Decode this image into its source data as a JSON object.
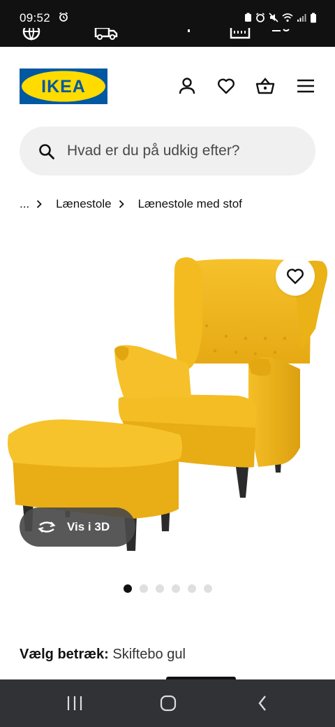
{
  "status": {
    "time": "09:52"
  },
  "brand": {
    "name": "IKEA",
    "colors": {
      "blue": "#0058a3",
      "yellow": "#ffdb00"
    }
  },
  "header": {
    "icons": [
      "user-icon",
      "heart-icon",
      "basket-icon",
      "menu-icon"
    ]
  },
  "search": {
    "placeholder": "Hvad er du på udkig efter?"
  },
  "breadcrumb": {
    "ellipsis": "...",
    "items": [
      "Lænestole",
      "Lænestole med stof"
    ]
  },
  "product": {
    "image_alt": "STRANDMON wing chair with footstool, Skiftebo yellow",
    "chair_color": "#f1b51c",
    "view3d_label": "Vis i 3D",
    "carousel": {
      "count": 6,
      "active_index": 0
    }
  },
  "cover": {
    "label": "Vælg betræk:",
    "value": "Skiftebo gul"
  }
}
